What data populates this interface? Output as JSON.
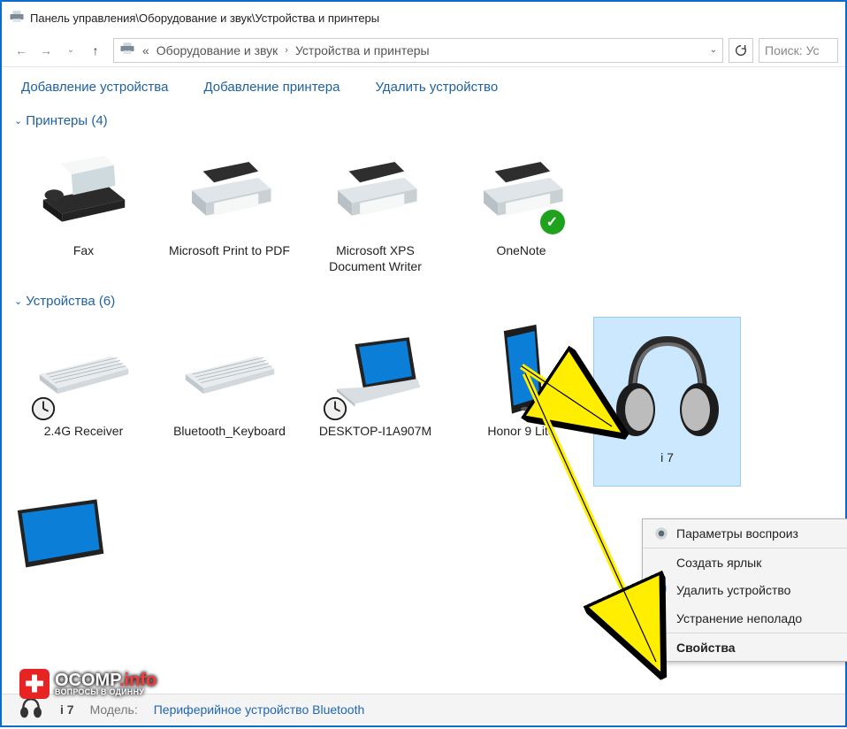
{
  "title": "Панель управления\\Оборудование и звук\\Устройства и принтеры",
  "breadcrumb": {
    "prefix": "«",
    "items": [
      "Оборудование и звук",
      "Устройства и принтеры"
    ]
  },
  "search": {
    "placeholder": "Поиск: Ус"
  },
  "toolbar": {
    "add_device": "Добавление устройства",
    "add_printer": "Добавление принтера",
    "delete_device": "Удалить устройство"
  },
  "groups": {
    "printers": {
      "title": "Принтеры (4)",
      "items": [
        {
          "name": "Fax",
          "icon": "fax"
        },
        {
          "name": "Microsoft Print to PDF",
          "icon": "printer"
        },
        {
          "name": "Microsoft XPS Document Writer",
          "icon": "printer"
        },
        {
          "name": "OneNote",
          "icon": "printer",
          "default": true
        }
      ]
    },
    "devices": {
      "title": "Устройства (6)",
      "items": [
        {
          "name": "2.4G Receiver",
          "icon": "keyboard",
          "pending": true
        },
        {
          "name": "Bluetooth_Keyboard",
          "icon": "keyboard"
        },
        {
          "name": "DESKTOP-I1A907M",
          "icon": "laptop",
          "pending": true
        },
        {
          "name": "Honor 9 Lite",
          "icon": "phone"
        },
        {
          "name": "i 7",
          "icon": "headphones",
          "selected": true
        },
        {
          "name": "",
          "icon": "monitor"
        }
      ]
    }
  },
  "context_menu": {
    "items": [
      {
        "label": "Параметры воспроиз",
        "icon": "speaker"
      },
      {
        "label": "Создать ярлык",
        "sep_before": true
      },
      {
        "label": "Удалить устройство",
        "icon": "shield"
      },
      {
        "label": "Устранение неполадо"
      },
      {
        "label": "Свойства",
        "bold": true,
        "sep_before": true
      }
    ]
  },
  "statusbar": {
    "name": "i 7",
    "model_label": "Модель:",
    "model_value": "Периферийное устройство Bluetooth"
  },
  "watermark": {
    "main": "OCOMP",
    "suffix": ".info",
    "sub": "ВОПРОСЫ В ОДИННУ"
  }
}
